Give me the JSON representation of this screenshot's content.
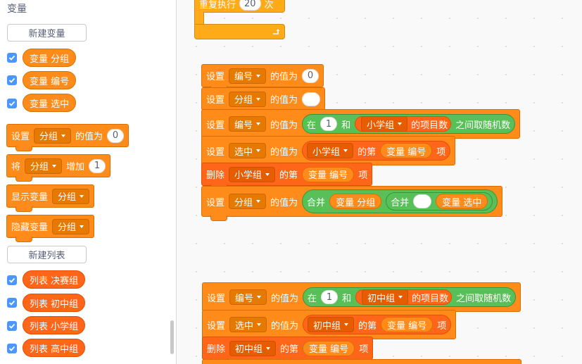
{
  "palette": {
    "category_title": "变量",
    "new_variable_button": "新建变量",
    "new_list_button": "新建列表",
    "variables": [
      {
        "name": "变量 分组",
        "checked": true
      },
      {
        "name": "变量 编号",
        "checked": true
      },
      {
        "name": "变量 选中",
        "checked": true
      }
    ],
    "blocks": {
      "set_label": "设置",
      "set_var": "分组",
      "set_to": "的值为",
      "set_value": "0",
      "change_label": "将",
      "change_var": "分组",
      "change_by": "增加",
      "change_value": "1",
      "show_label": "显示变量",
      "show_var": "分组",
      "hide_label": "隐藏变量",
      "hide_var": "分组"
    },
    "lists": [
      {
        "name": "列表 决赛组",
        "checked": true
      },
      {
        "name": "列表 初中组",
        "checked": true
      },
      {
        "name": "列表 小学组",
        "checked": true
      },
      {
        "name": "列表 高中组",
        "checked": true
      }
    ]
  },
  "workspace": {
    "repeat": {
      "label": "重复执行",
      "count": "20",
      "unit": "次",
      "loop_icon": "loop-arrow-icon"
    },
    "script1": {
      "b1": {
        "label": "设置",
        "var": "编号",
        "to": "的值为",
        "value": "0"
      },
      "b2": {
        "label": "设置",
        "var": "分组",
        "to": "的值为",
        "value": ""
      },
      "b3": {
        "label": "设置",
        "var": "编号",
        "to": "的值为",
        "op_in": "在",
        "from": "1",
        "and": "和",
        "list": "小学组",
        "item_count": "的项目数",
        "op_end": "之间取随机数"
      },
      "b4": {
        "label": "设置",
        "var": "选中",
        "to": "的值为",
        "list": "小学组",
        "of_item": "的第",
        "index_var": "变量 编号",
        "item": "项"
      },
      "b5": {
        "label": "删除",
        "list": "小学组",
        "of_item": "的第",
        "index_var": "变量 编号",
        "item": "项"
      },
      "b6": {
        "label": "设置",
        "var": "分组",
        "to": "的值为",
        "join1": "合并",
        "left_var": "变量 分组",
        "join2": "合并",
        "mid_value": "",
        "right_var": "变量 选中"
      }
    },
    "script2": {
      "b1": {
        "label": "设置",
        "var": "编号",
        "to": "的值为",
        "op_in": "在",
        "from": "1",
        "and": "和",
        "list": "初中组",
        "item_count": "的项目数",
        "op_end": "之间取随机数"
      },
      "b2": {
        "label": "设置",
        "var": "选中",
        "to": "的值为",
        "list": "初中组",
        "of_item": "的第",
        "index_var": "变量 编号",
        "item": "项"
      },
      "b3": {
        "label": "删除",
        "list": "初中组",
        "of_item": "的第",
        "index_var": "变量 编号",
        "item": "项"
      }
    }
  }
}
